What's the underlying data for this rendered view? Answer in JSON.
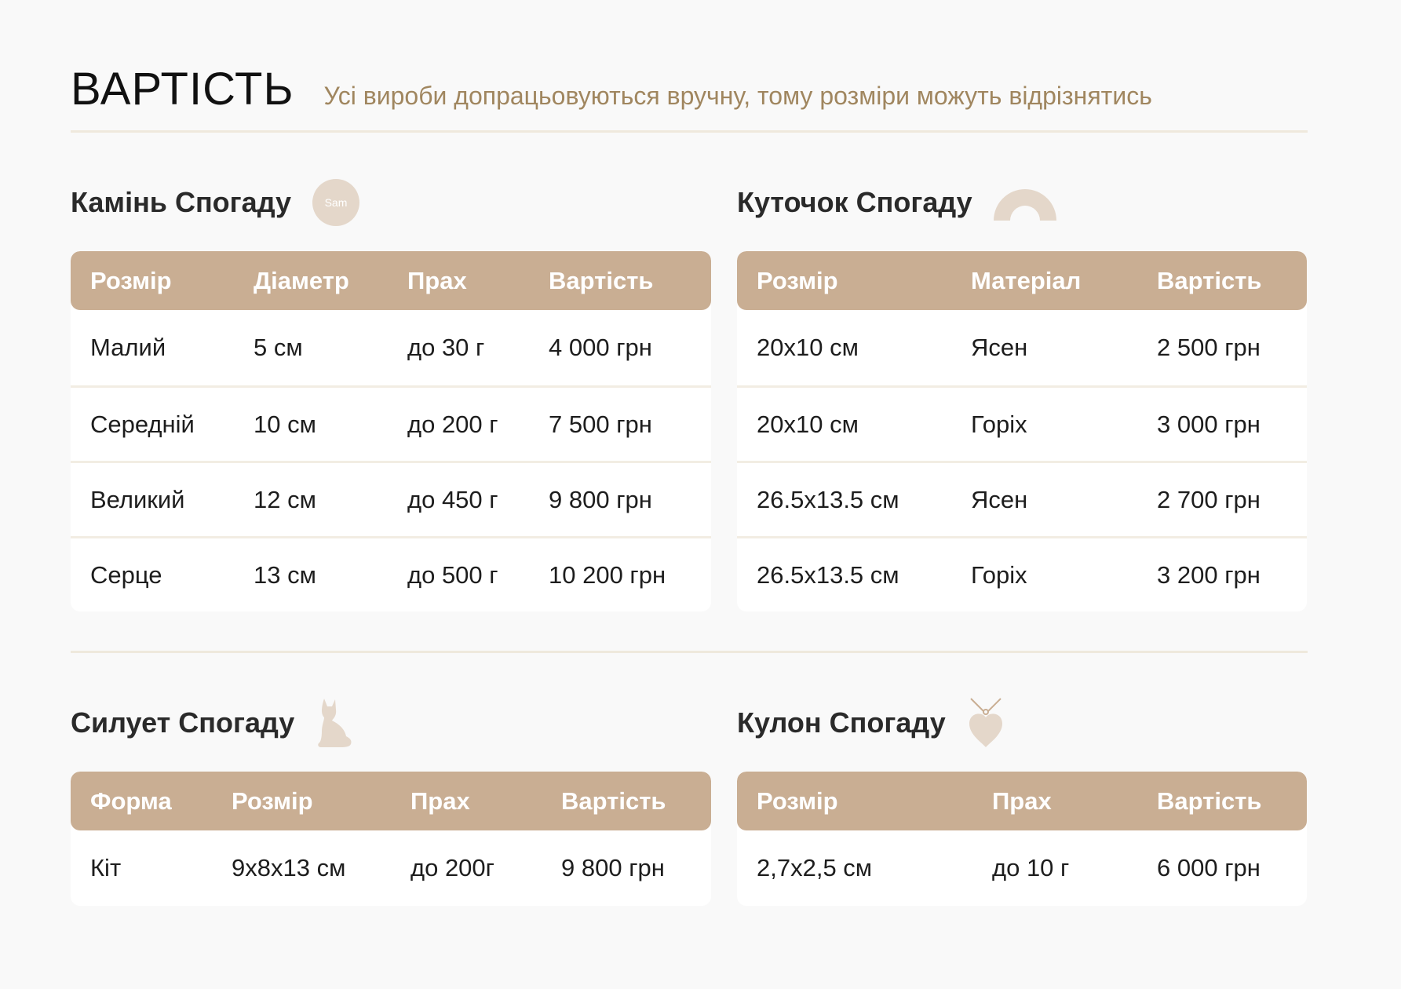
{
  "header": {
    "title": "ВАРТІСТЬ",
    "subtitle": "Усі вироби допрацьовуються вручну, тому розміри можуть відрізнятись"
  },
  "colors": {
    "accent": "#c9ae93",
    "subtitle": "#a0865f",
    "icon": "#e4d7ca",
    "divider": "#efe9dd"
  },
  "sections": [
    {
      "title": "Камінь Спогаду",
      "icon": "sam-stone-icon",
      "icon_text": "Sam",
      "columns": [
        "Розмір",
        "Діаметр",
        "Прах",
        "Вартість"
      ],
      "rows": [
        [
          "Малий",
          "5 см",
          "до 30 г",
          "4 000 грн"
        ],
        [
          "Середній",
          "10 см",
          "до 200 г",
          "7 500 грн"
        ],
        [
          "Великий",
          "12 см",
          "до 450 г",
          "9 800 грн"
        ],
        [
          "Серце",
          "13 см",
          "до 500 г",
          "10 200 грн"
        ]
      ]
    },
    {
      "title": "Куточок Спогаду",
      "icon": "arch-icon",
      "columns": [
        "Розмір",
        "Матеріал",
        "Вартість"
      ],
      "rows": [
        [
          "20х10 см",
          "Ясен",
          "2 500 грн"
        ],
        [
          "20х10 см",
          "Горіх",
          "3 000 грн"
        ],
        [
          "26.5х13.5 см",
          "Ясен",
          "2 700 грн"
        ],
        [
          "26.5х13.5 см",
          "Горіх",
          "3 200 грн"
        ]
      ]
    },
    {
      "title": "Силует Спогаду",
      "icon": "cat-silhouette-icon",
      "columns": [
        "Форма",
        "Розмір",
        "Прах",
        "Вартість"
      ],
      "rows": [
        [
          "Кіт",
          "9х8х13 см",
          "до 200г",
          "9 800 грн"
        ]
      ]
    },
    {
      "title": "Кулон Спогаду",
      "icon": "heart-pendant-icon",
      "columns": [
        "Розмір",
        "Прах",
        "Вартість"
      ],
      "rows": [
        [
          "2,7х2,5 см",
          "до 10 г",
          "6 000 грн"
        ]
      ]
    }
  ]
}
